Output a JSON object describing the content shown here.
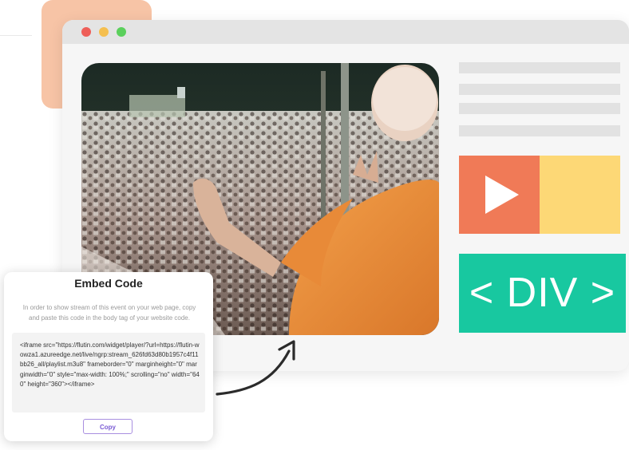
{
  "colors": {
    "peach": "#f7c4a6",
    "dot_red": "#ee5e58",
    "dot_yellow": "#f5bf4f",
    "dot_green": "#5bd05c",
    "player_orange": "#f07a57",
    "player_yellow": "#fdd876",
    "div_green": "#18c8a0"
  },
  "icons": {
    "play": "play-icon",
    "arrow": "curved-arrow-icon"
  },
  "div_block": {
    "label": "< DIV >"
  },
  "embed": {
    "title": "Embed Code",
    "description": "In order to show stream of this event on your web page, copy and paste this code in the body tag of your website code.",
    "code": "<iframe src=\"https://flutin.com/widget/player/?url=https://flutin-wowza1.azureedge.net/live/ngrp:stream_626fd63d80b1957c4f11bb26_all/playlist.m3u8\" frameborder=\"0\" marginheight=\"0\" marginwidth=\"0\" style=\"max-width: 100%;\" scrolling=\"no\" width=\"640\" height=\"360\"></iframe>",
    "copy_label": "Copy"
  }
}
